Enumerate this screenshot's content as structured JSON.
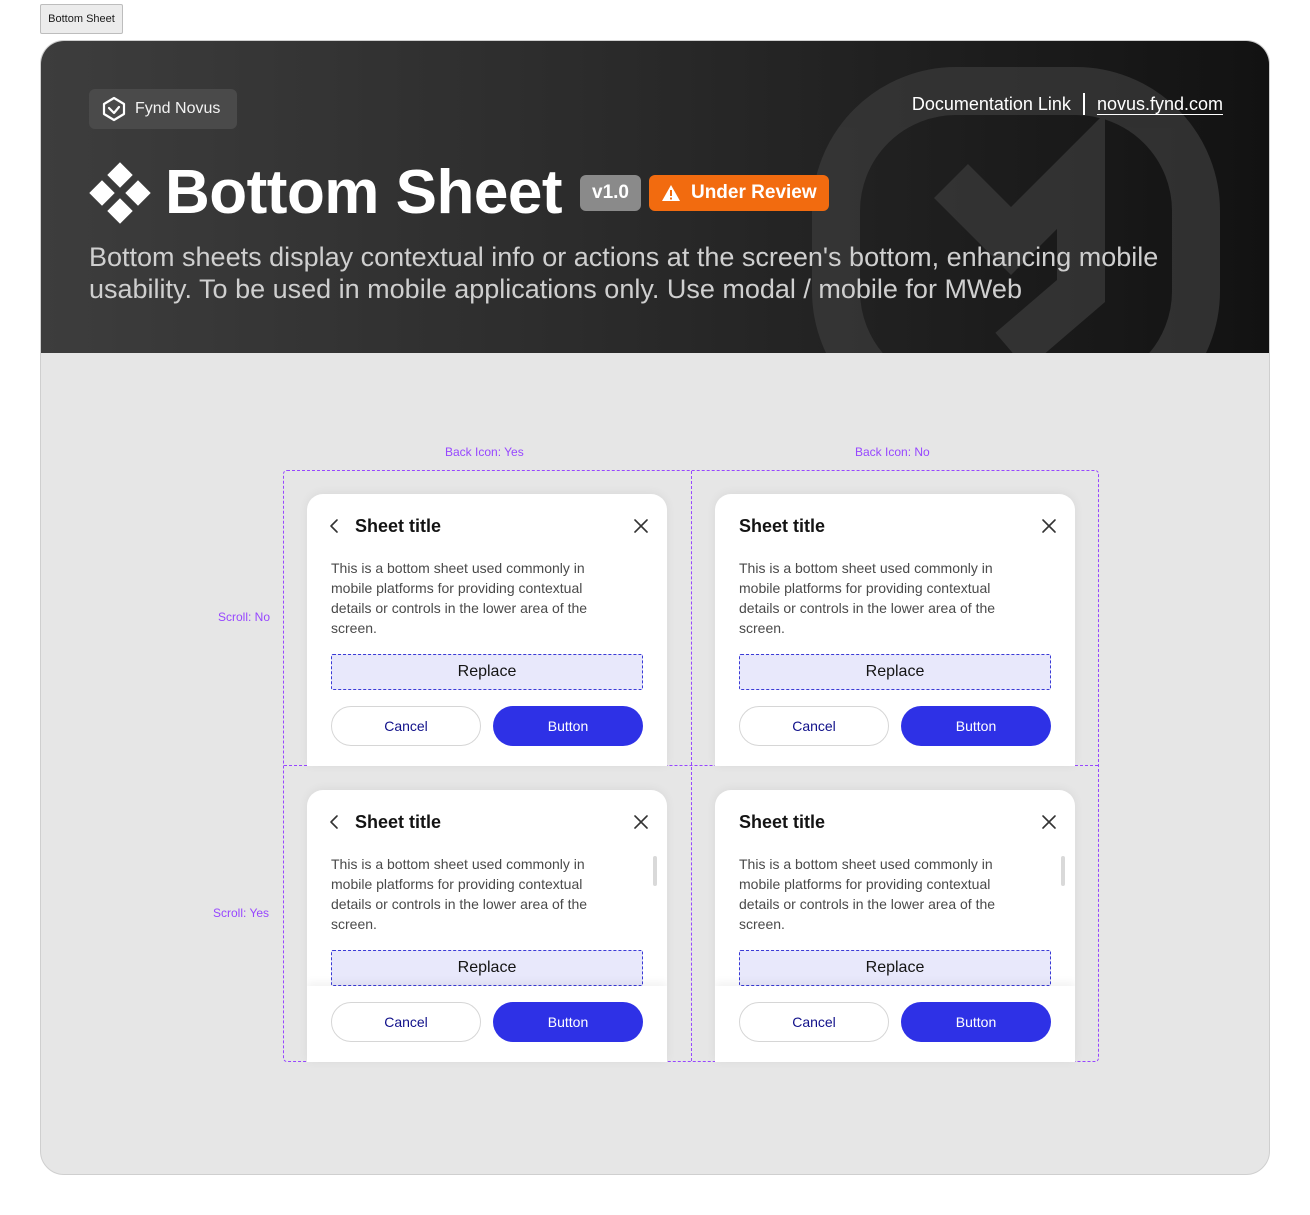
{
  "page_tab": "Bottom Sheet",
  "header": {
    "brand": "Fynd Novus",
    "doc_link_label": "Documentation Link",
    "doc_link_url": "novus.fynd.com",
    "title": "Bottom Sheet",
    "version": "v1.0",
    "status": "Under Review",
    "status_color": "#f26b0f",
    "description": "Bottom sheets display contextual info or actions at the screen's bottom, enhancing mobile usability. To be used in mobile applications only. Use modal / mobile for MWeb"
  },
  "variants": {
    "columns": [
      "Back Icon: Yes",
      "Back Icon: No"
    ],
    "rows": [
      "Scroll: No",
      "Scroll: Yes"
    ]
  },
  "sheets": [
    {
      "title": "Sheet title",
      "body": "This is a bottom sheet used commonly in mobile platforms for providing contextual details or controls in the lower area of the screen.",
      "slot": "Replace",
      "cancel": "Cancel",
      "primary": "Button"
    },
    {
      "title": "Sheet title",
      "body": "This is a bottom sheet used commonly in mobile platforms for providing contextual details or controls in the lower area of the screen.",
      "slot": "Replace",
      "cancel": "Cancel",
      "primary": "Button"
    },
    {
      "title": "Sheet title",
      "body": "This is a bottom sheet used commonly in mobile platforms for providing contextual details or controls in the lower area of the screen.",
      "slot": "Replace",
      "cancel": "Cancel",
      "primary": "Button"
    },
    {
      "title": "Sheet title",
      "body": "This is a bottom sheet used commonly in mobile platforms for providing contextual details or controls in the lower area of the screen.",
      "slot": "Replace",
      "cancel": "Cancel",
      "primary": "Button"
    }
  ],
  "colors": {
    "primary_button": "#2e31e6",
    "annotation": "#9747ff",
    "slot_fill": "#e8e8fb"
  }
}
